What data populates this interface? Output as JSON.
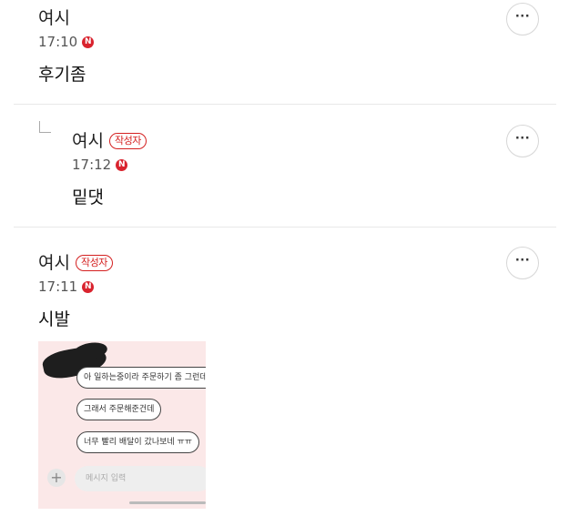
{
  "comments": [
    {
      "author": "여시",
      "time": "17:10",
      "text": "후기좀"
    },
    {
      "author": "여시",
      "author_badge": "작성자",
      "time": "17:12",
      "text": "밑댓"
    },
    {
      "author": "여시",
      "author_badge": "작성자",
      "time": "17:11",
      "text": "시발"
    }
  ],
  "time_badge": "N",
  "more_label": "···",
  "attachment": {
    "bubbles": [
      "아 일하는중이라 주문하기 좀 그런데",
      "그래서 주문해준건데",
      "너무 빨리 배달이 갔나보네 ㅠㅠ"
    ],
    "plus": "+",
    "input_placeholder": "메시지 입력"
  },
  "colors": {
    "accent": "#d42020",
    "badge_bg": "#d9232e"
  }
}
